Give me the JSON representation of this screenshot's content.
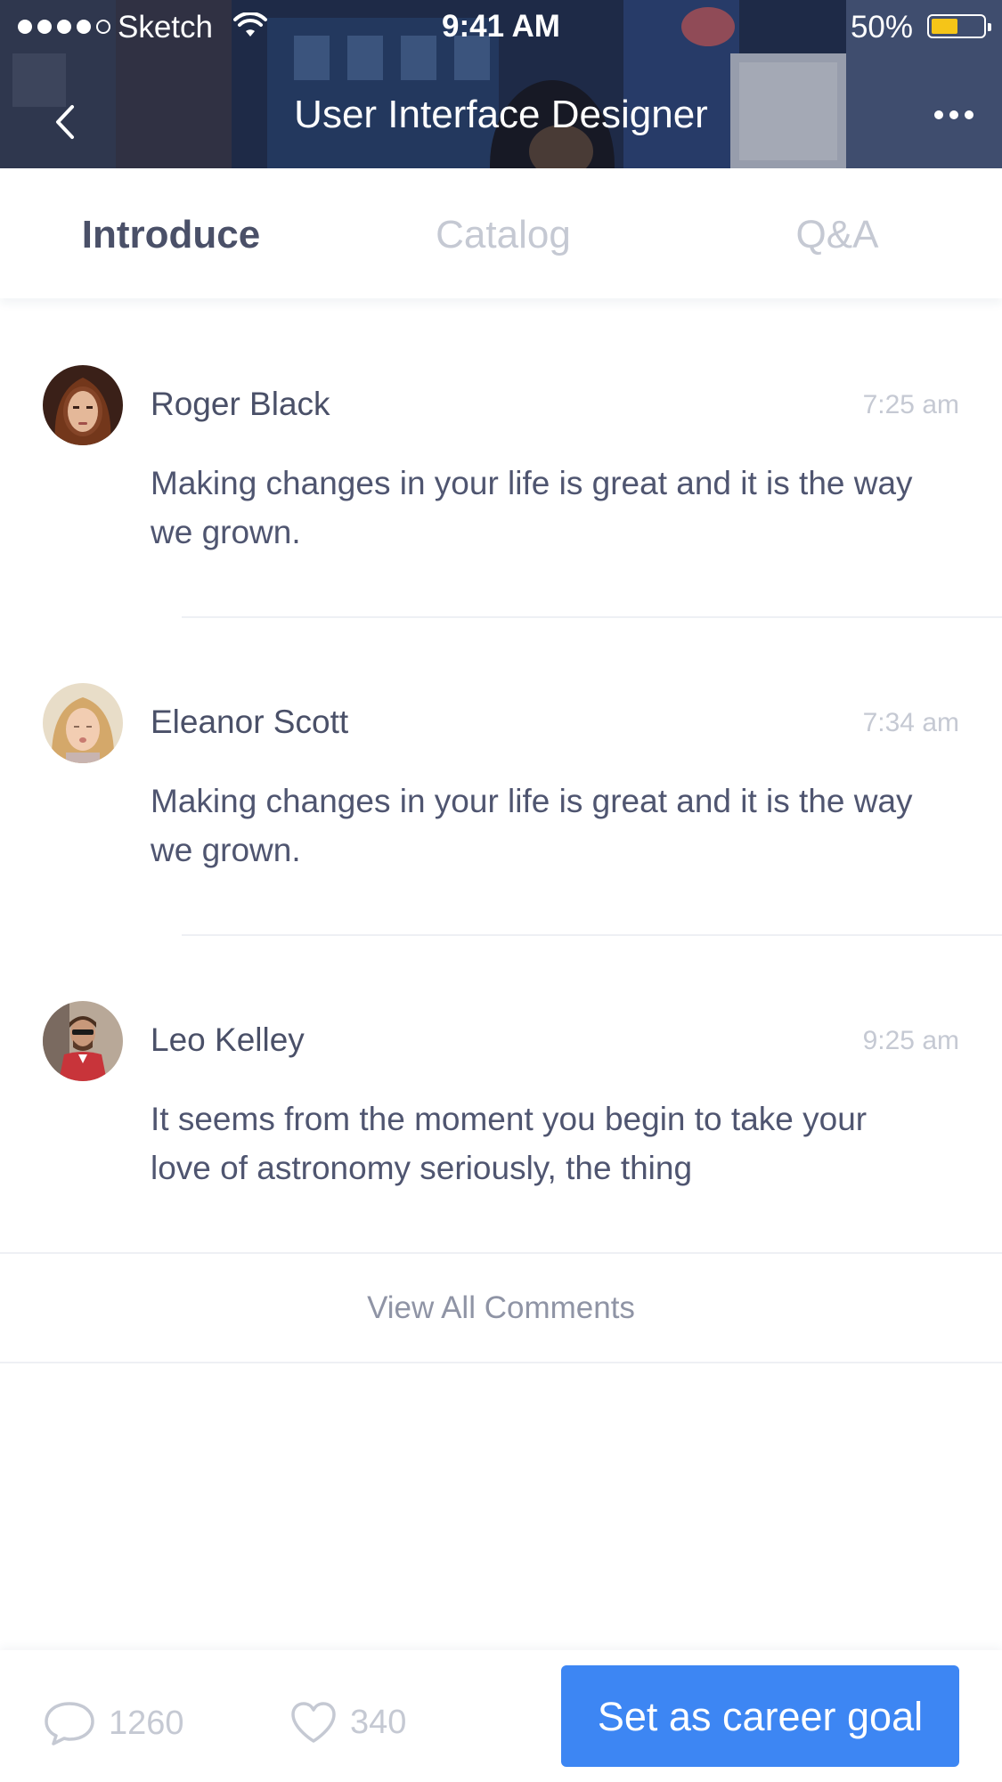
{
  "status_bar": {
    "carrier": "Sketch",
    "time": "9:41 AM",
    "battery_percent": "50%",
    "battery_level": 0.5
  },
  "nav": {
    "title": "User Interface Designer",
    "back_icon": "chevron-left-icon",
    "more_icon": "more-horizontal-icon"
  },
  "tabs": [
    {
      "label": "Introduce",
      "active": true
    },
    {
      "label": "Catalog",
      "active": false
    },
    {
      "label": "Q&A",
      "active": false
    }
  ],
  "comments": [
    {
      "name": "Roger Black",
      "time": "7:25 am",
      "text": "Making changes in your life is great and it is the way we grown."
    },
    {
      "name": "Eleanor Scott",
      "time": "7:34 am",
      "text": "Making changes in your life is great and it is the way we grown."
    },
    {
      "name": "Leo Kelley",
      "time": "9:25 am",
      "text": "It seems from the moment you begin to take your love of astronomy seriously, the thing"
    }
  ],
  "view_all_label": "View All Comments",
  "bottom_bar": {
    "comment_count": "1260",
    "like_count": "340",
    "cta_label": "Set as career goal"
  },
  "colors": {
    "accent": "#3d86f3",
    "text_primary": "#4a5068",
    "text_muted": "#c5c9d3",
    "battery": "#f5c518"
  }
}
